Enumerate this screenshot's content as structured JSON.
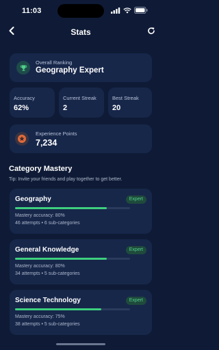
{
  "status_bar": {
    "time": "11:03"
  },
  "header": {
    "title": "Stats"
  },
  "ranking": {
    "label": "Overall Ranking",
    "value": "Geography Expert"
  },
  "stats": [
    {
      "label": "Accuracy",
      "value": "62%"
    },
    {
      "label": "Current Streak",
      "value": "2"
    },
    {
      "label": "Best Streak",
      "value": "20"
    }
  ],
  "experience": {
    "label": "Experience Points",
    "value": "7,234"
  },
  "mastery": {
    "title": "Category Mastery",
    "tip": "Tip: Invite your friends and play together to get better.",
    "categories": [
      {
        "name": "Geography",
        "badge": "Expert",
        "progress": 0.8,
        "accuracy": "Mastery accuracy: 80%",
        "meta": "46 attempts • 6 sub-categories"
      },
      {
        "name": "General Knowledge",
        "badge": "Expert",
        "progress": 0.8,
        "accuracy": "Mastery accuracy: 80%",
        "meta": "34 attempts • 5 sub-categories"
      },
      {
        "name": "Science Technology",
        "badge": "Expert",
        "progress": 0.75,
        "accuracy": "Mastery accuracy: 75%",
        "meta": "38 attempts • 5 sub-categories"
      }
    ]
  },
  "colors": {
    "background": "#0f1b36",
    "card": "#17274a",
    "accent_green": "#3ecf7e",
    "badge_bg": "#1f4a3c"
  },
  "icons": {
    "back": "chevron-left-icon",
    "refresh": "refresh-icon",
    "ranking": "trophy-icon",
    "experience": "star-medal-icon"
  }
}
